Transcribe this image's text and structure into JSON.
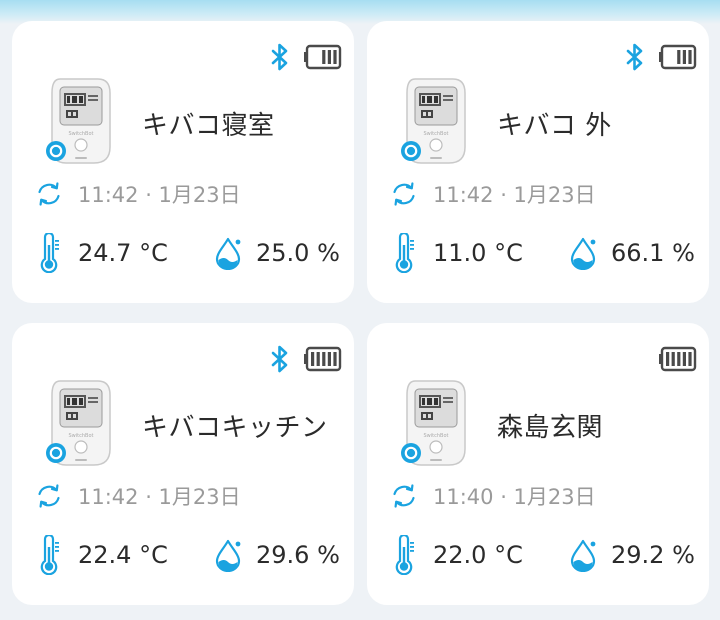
{
  "colors": {
    "accent": "#1aa3e0",
    "text": "#2b2b2b",
    "muted": "#9a9a9a",
    "icon_gray": "#4a4a4a"
  },
  "cards": [
    {
      "name": "キバコ寝室",
      "time": "11:42 · 1月23日",
      "temperature": "24.7 °C",
      "humidity": "25.0 %",
      "bluetooth": true,
      "battery_level": 0.5
    },
    {
      "name": "キバコ 外",
      "time": "11:42 · 1月23日",
      "temperature": "11.0 °C",
      "humidity": "66.1 %",
      "bluetooth": true,
      "battery_level": 0.5
    },
    {
      "name": "キバコキッチン",
      "time": "11:42 · 1月23日",
      "temperature": "22.4 °C",
      "humidity": "29.6 %",
      "bluetooth": true,
      "battery_level": 1.0
    },
    {
      "name": "森島玄関",
      "time": "11:40 · 1月23日",
      "temperature": "22.0 °C",
      "humidity": "29.2 %",
      "bluetooth": false,
      "battery_level": 1.0
    }
  ]
}
